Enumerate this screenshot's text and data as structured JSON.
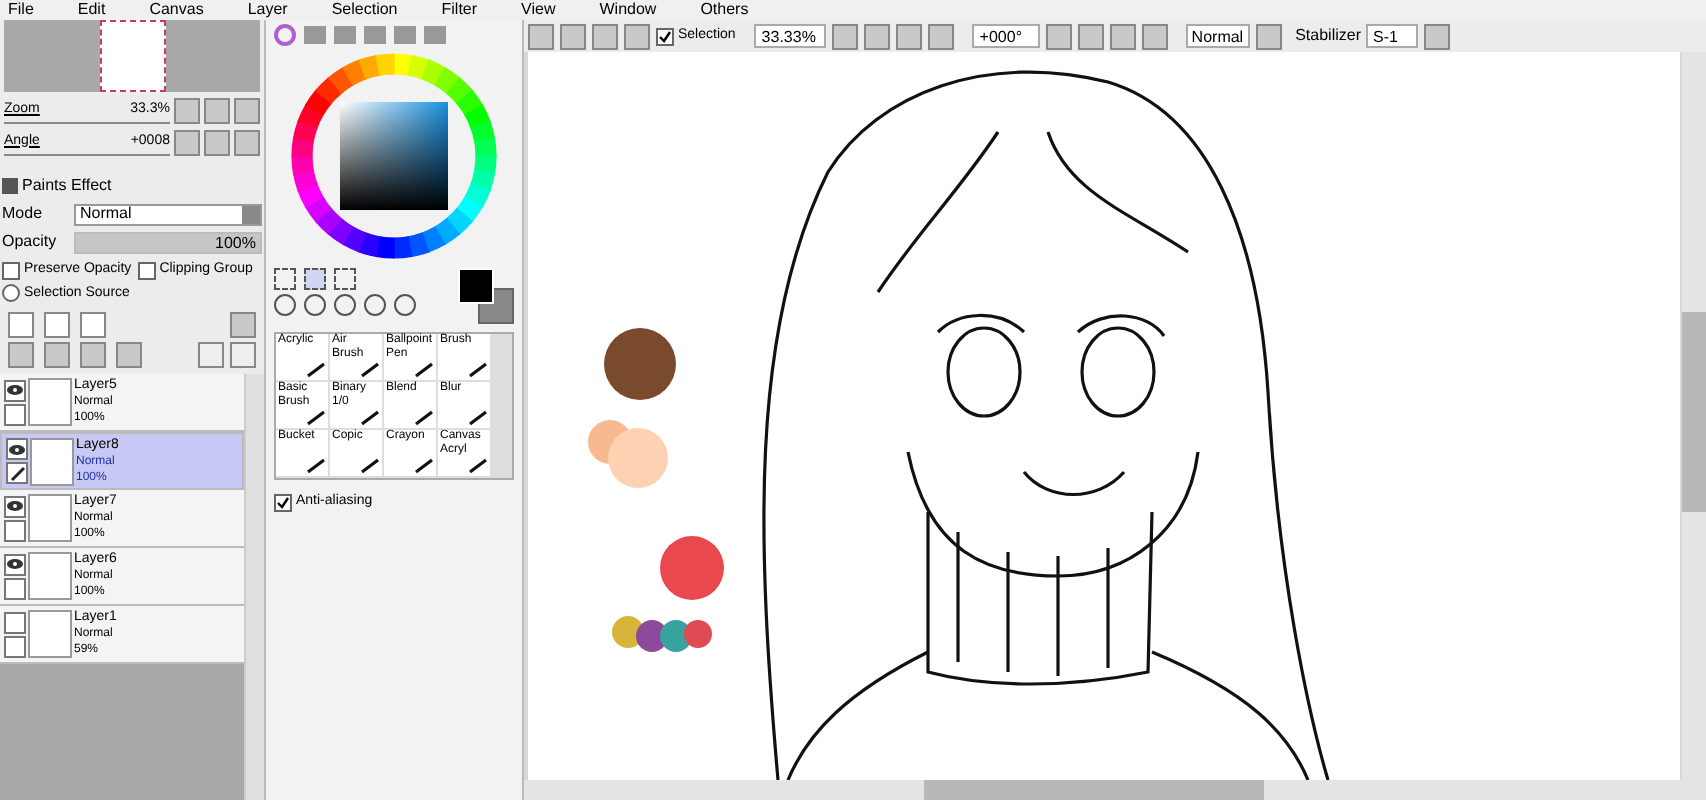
{
  "menu": [
    "File",
    "Edit",
    "Canvas",
    "Layer",
    "Selection",
    "Filter",
    "View",
    "Window",
    "Others"
  ],
  "navigator": {
    "zoom_label": "Zoom",
    "zoom_value": "33.3%",
    "angle_label": "Angle",
    "angle_value": "+0008"
  },
  "paints_effect": {
    "title": "Paints Effect",
    "mode_label": "Mode",
    "mode_value": "Normal",
    "opacity": {
      "label": "Opacity",
      "value": "100%",
      "level": 1
    },
    "preserve_opacity": {
      "label": "Preserve Opacity",
      "checked": false
    },
    "clipping_group": {
      "label": "Clipping Group",
      "checked": false
    },
    "selection_source": {
      "label": "Selection Source",
      "selected": false
    }
  },
  "layers": [
    {
      "name": "Layer5",
      "mode": "Normal",
      "opacity": "100%",
      "visible": true,
      "selected": false,
      "pen": false
    },
    {
      "name": "Layer8",
      "mode": "Normal",
      "opacity": "100%",
      "visible": true,
      "selected": true,
      "pen": true
    },
    {
      "name": "Layer7",
      "mode": "Normal",
      "opacity": "100%",
      "visible": true,
      "selected": false,
      "pen": false
    },
    {
      "name": "Layer6",
      "mode": "Normal",
      "opacity": "100%",
      "visible": true,
      "selected": false,
      "pen": false
    },
    {
      "name": "Layer1",
      "mode": "Normal",
      "opacity": "59%",
      "visible": false,
      "selected": false,
      "pen": false
    }
  ],
  "brushes": [
    {
      "line1": "Acrylic"
    },
    {
      "line1": "Air",
      "line2": "Brush"
    },
    {
      "line1": "Ballpoint",
      "line2": "Pen"
    },
    {
      "line1": "Brush"
    },
    {
      "line1": "Basic",
      "line2": "Brush"
    },
    {
      "line1": "Binary",
      "line2": "1/0"
    },
    {
      "line1": "Blend"
    },
    {
      "line1": "Blur"
    },
    {
      "line1": "Bucket"
    },
    {
      "line1": "Copic"
    },
    {
      "line1": "Crayon"
    },
    {
      "line1": "Canvas",
      "line2": "Acryl"
    }
  ],
  "anti_aliasing": {
    "label": "Anti-aliasing",
    "checked": true
  },
  "toolbar": {
    "selection": {
      "label": "Selection",
      "checked": true
    },
    "zoom": "33.33%",
    "angle": "+000°",
    "blend": "Normal",
    "stabilizer_label": "Stabilizer",
    "stabilizer_value": "S-1"
  },
  "paint_blobs": [
    {
      "color": "#7a4a2c"
    },
    {
      "color": "#f7b98e"
    },
    {
      "color": "#fcd2b2"
    },
    {
      "color": "#e8484e"
    },
    {
      "color": "#d8b43a"
    },
    {
      "color": "#8d4a9a"
    },
    {
      "color": "#3aa3a0"
    },
    {
      "color": "#e04a52"
    }
  ]
}
